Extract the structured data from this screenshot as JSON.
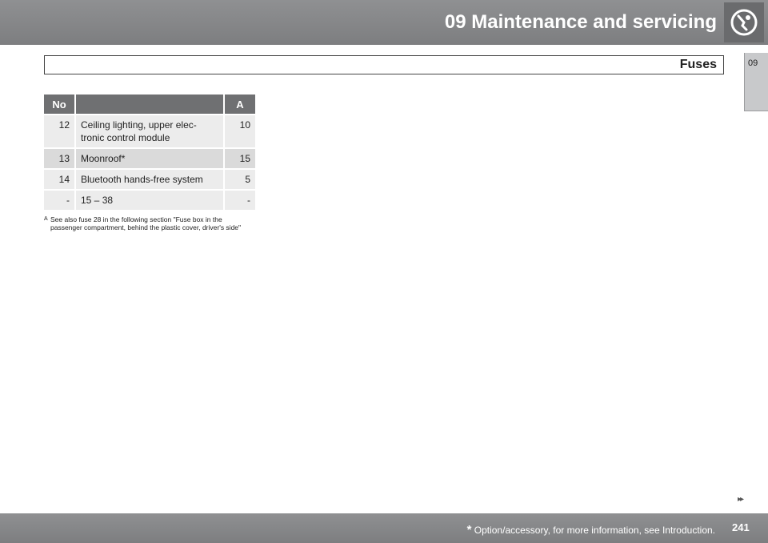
{
  "header": {
    "title": "09 Maintenance and servicing",
    "icon": "wrench-icon"
  },
  "chapter_tab": {
    "label": "09"
  },
  "section": {
    "title": "Fuses"
  },
  "table": {
    "columns": [
      "No",
      "",
      "A"
    ],
    "rows": [
      {
        "no": "12",
        "description": "Ceiling lighting, upper elec-tronic control module",
        "amps": "10"
      },
      {
        "no": "13",
        "description": "Moonroof*",
        "amps": "15"
      },
      {
        "no": "14",
        "description": "Bluetooth hands-free system",
        "amps": "5"
      },
      {
        "no": "-",
        "description": "15 – 38",
        "amps": "-"
      }
    ]
  },
  "footnote": {
    "marker": "A",
    "text": "See also fuse 28 in the following section \"Fuse box in the passenger compartment, behind the plastic cover, driver's side\""
  },
  "navigation": {
    "next_arrows": "▸▸"
  },
  "footer": {
    "star": "*",
    "note": "Option/accessory, for more information, see Introduction.",
    "page_number": "241"
  }
}
